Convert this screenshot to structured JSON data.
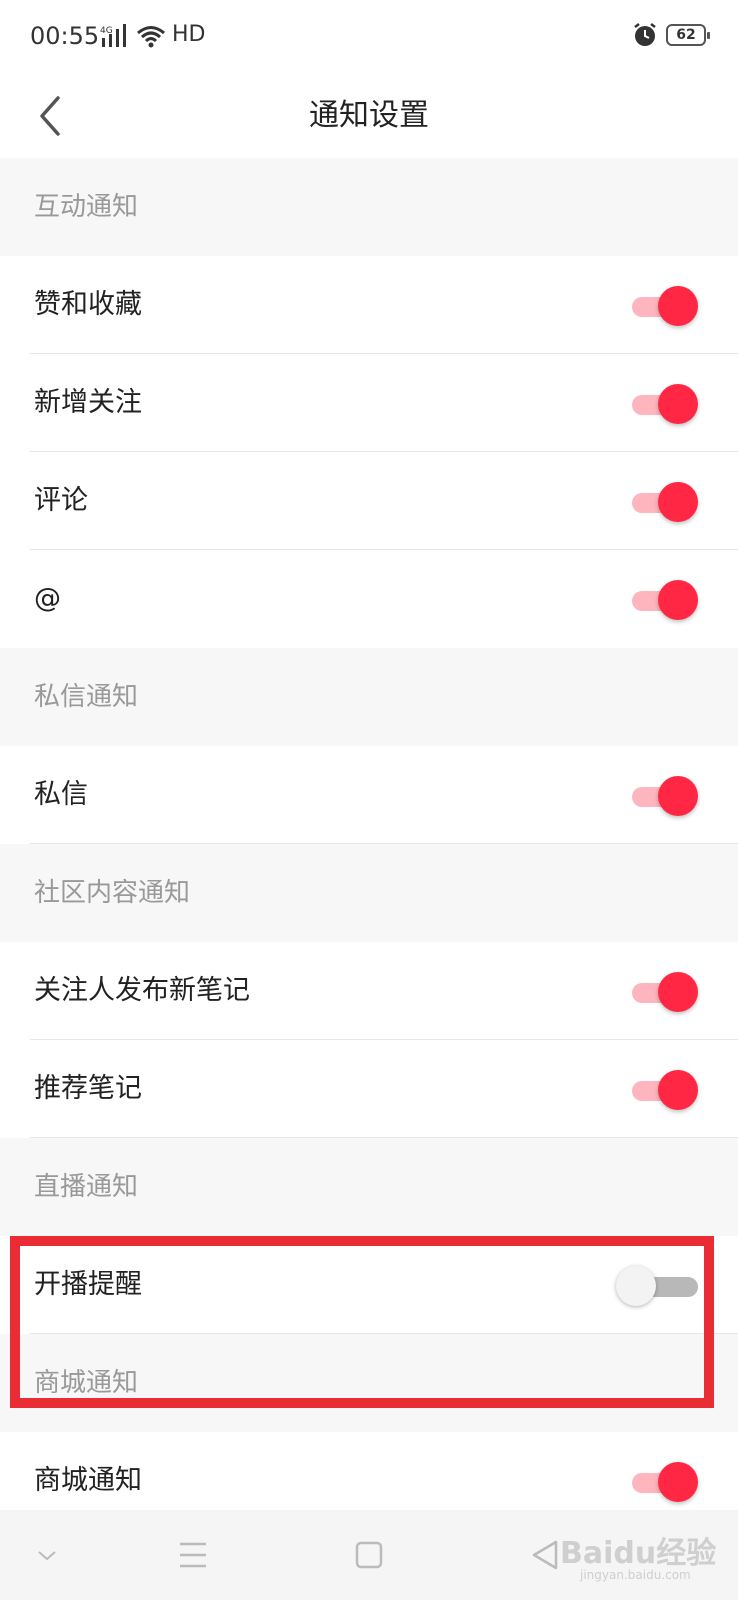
{
  "status_bar": {
    "time": "00:55",
    "network": "4G",
    "hd": "HD",
    "battery": "62"
  },
  "header": {
    "title": "通知设置"
  },
  "sections": [
    {
      "title": "互动通知",
      "items": [
        {
          "label": "赞和收藏",
          "enabled": true
        },
        {
          "label": "新增关注",
          "enabled": true
        },
        {
          "label": "评论",
          "enabled": true
        },
        {
          "label": "@",
          "enabled": true
        }
      ]
    },
    {
      "title": "私信通知",
      "items": [
        {
          "label": "私信",
          "enabled": true
        }
      ]
    },
    {
      "title": "社区内容通知",
      "items": [
        {
          "label": "关注人发布新笔记",
          "enabled": true
        },
        {
          "label": "推荐笔记",
          "enabled": true
        }
      ]
    },
    {
      "title": "直播通知",
      "items": [
        {
          "label": "开播提醒",
          "enabled": false
        }
      ]
    },
    {
      "title": "商城通知",
      "items": [
        {
          "label": "商城通知",
          "enabled": true
        }
      ]
    }
  ],
  "colors": {
    "accent": "#ff2744",
    "accent_track": "#ffb5bd",
    "highlight_box": "#ea2d34"
  },
  "watermark": {
    "logo": "Baidu经验",
    "url": "jingyan.baidu.com"
  }
}
